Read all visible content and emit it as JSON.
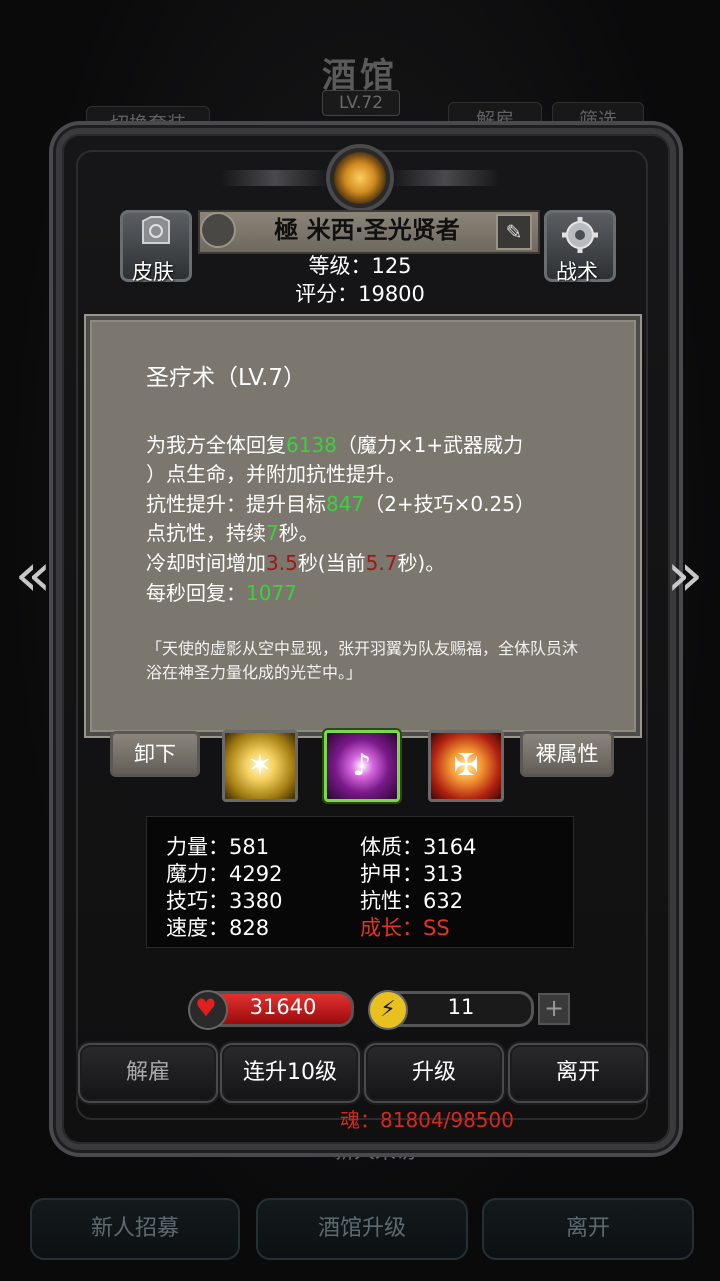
{
  "background": {
    "title": "酒馆",
    "level": "LV.72",
    "switch_outfit": "切换套装",
    "dismiss": "解雇",
    "filter": "筛选",
    "new_visitor": "新人来访",
    "recruit": "新人招募",
    "tavern_upgrade": "酒馆升级",
    "leave": "离开"
  },
  "hero": {
    "skin_label": "皮肤",
    "tactics_label": "战术",
    "name": "極 米西·圣光贤者",
    "level_text": "等级：125",
    "score_text": "评分：19800"
  },
  "skill_card": {
    "title": "圣疗术（LV.7）",
    "line1_a": "为我方全体回复",
    "line1_val": "6138",
    "line1_b": "（魔力×1+武器威力",
    "line2": "）点生命，并附加抗性提升。",
    "line3_a": "抗性提升：提升目标",
    "line3_val": "847",
    "line3_b": "（2+技巧×0.25）",
    "line4_a": "点抗性，持续",
    "line4_val": "7",
    "line4_b": "秒。",
    "line5_a": "冷却时间增加",
    "line5_val": "3.5",
    "line5_b": "秒(当前",
    "line5_val2": "5.7",
    "line5_c": "秒)。",
    "line6_a": "每秒回复：",
    "line6_val": "1077",
    "flavor": "「天使的虚影从空中显现，张开羽翼为队友赐福，全体队员沐浴在神圣力量化成的光芒中。」"
  },
  "skills_row": {
    "unequip": "卸下",
    "naked_attr": "裸属性"
  },
  "attributes": {
    "strength": "力量：581",
    "constitution": "体质：3164",
    "magic": "魔力：4292",
    "armor": "护甲：313",
    "skill": "技巧：3380",
    "resistance": "抗性：632",
    "speed": "速度：828",
    "growth": "成长：SS"
  },
  "bars": {
    "hp": "31640",
    "energy": "11",
    "energy_fraction": 0.08
  },
  "actions": {
    "dismiss": "解雇",
    "level_up_10": "连升10级",
    "level_up": "升级",
    "leave": "离开"
  },
  "soul_text": "魂：81804/98500",
  "colors": {
    "value_green": "#3ad23a",
    "value_red": "#a01810",
    "growth_red": "#e8331c",
    "card_bg": "#7b776e"
  },
  "icons": [
    "skin-icon",
    "gear-icon",
    "badge-icon",
    "edit-icon",
    "left-arrow-icon",
    "right-arrow-icon",
    "heart-icon",
    "lightning-icon",
    "plus-icon"
  ]
}
